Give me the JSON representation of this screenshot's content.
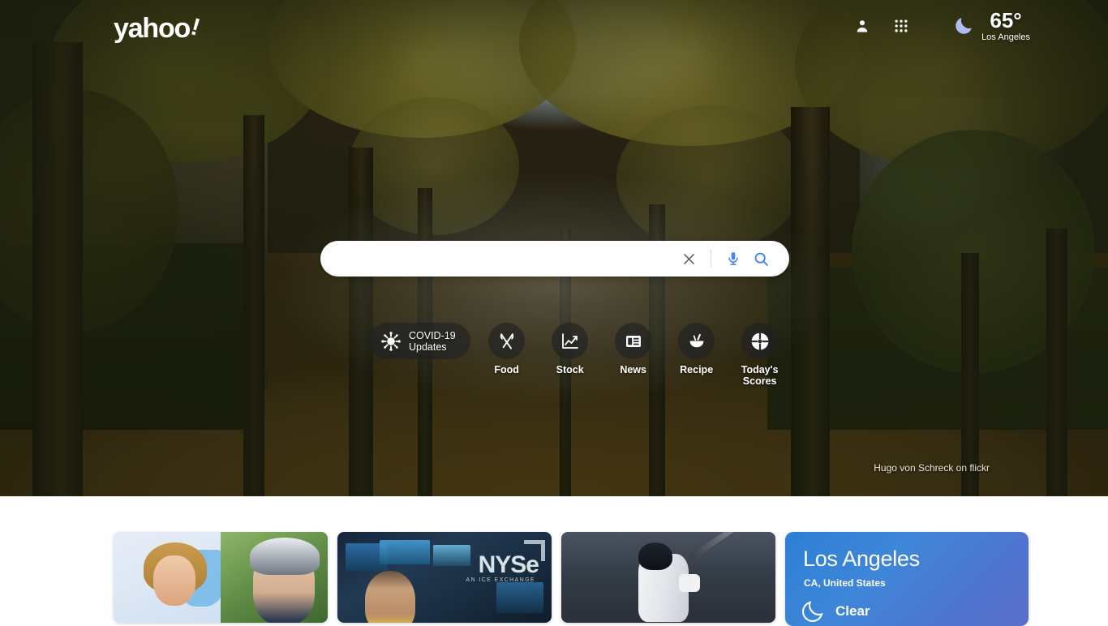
{
  "brand": {
    "logo_text": "yahoo",
    "logo_bang": "!"
  },
  "header": {
    "profile_icon": "person-icon",
    "apps_icon": "apps-grid-icon",
    "weather_icon": "crescent-moon-icon",
    "temperature": "65°",
    "location": "Los Angeles"
  },
  "search": {
    "value": "",
    "placeholder": "",
    "clear_icon": "close-icon",
    "mic_icon": "microphone-icon",
    "search_icon": "search-icon",
    "accent_color": "#4285f4"
  },
  "shortcuts": {
    "covid": {
      "label_line1": "COVID-19",
      "label_line2": "Updates",
      "icon": "virus-icon"
    },
    "items": [
      {
        "label": "Food",
        "icon": "fork-knife-icon"
      },
      {
        "label": "Stock",
        "icon": "line-chart-icon"
      },
      {
        "label": "News",
        "icon": "newspaper-icon"
      },
      {
        "label": "Recipe",
        "icon": "mortar-pestle-icon"
      },
      {
        "label": "Today's Scores",
        "icon": "basketball-icon"
      }
    ]
  },
  "hero": {
    "photo_credit": "Hugo von Schreck on flickr"
  },
  "content": {
    "cards": [
      {
        "name": "politics-news-card",
        "kind": "split-portraits"
      },
      {
        "name": "markets-news-card",
        "kind": "nyse",
        "overlay_text": "NYSe",
        "overlay_sub": "AN ICE EXCHANGE"
      },
      {
        "name": "sports-news-card",
        "kind": "baseball"
      }
    ],
    "weather_card": {
      "city": "Los Angeles",
      "region": "CA, United States",
      "condition": "Clear",
      "icon": "crescent-moon-icon",
      "gradient_from": "#2c7fd6",
      "gradient_to": "#5a6fc9"
    }
  }
}
